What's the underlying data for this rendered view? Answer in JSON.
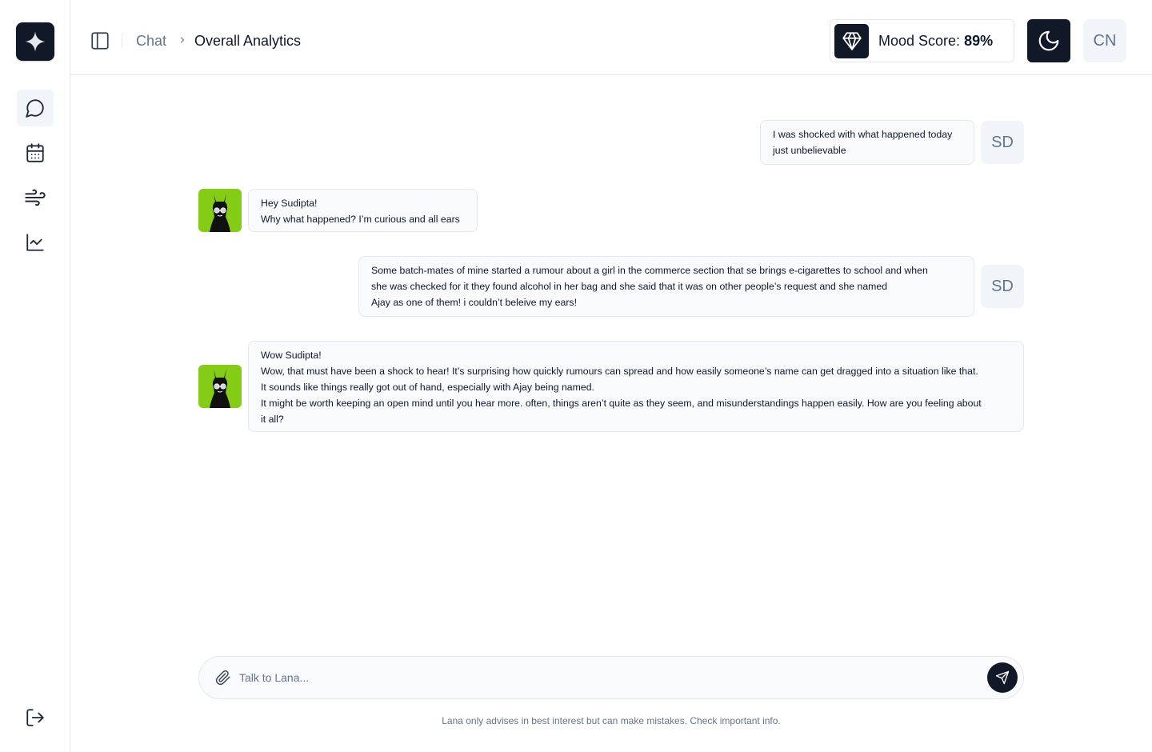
{
  "sidebar": {
    "logo": "sparkle-icon",
    "items": [
      {
        "icon": "chat-bubble-icon",
        "active": true
      },
      {
        "icon": "calendar-icon",
        "active": false
      },
      {
        "icon": "wind-icon",
        "active": false
      },
      {
        "icon": "area-chart-icon",
        "active": false
      }
    ],
    "logout_icon": "logout-icon"
  },
  "header": {
    "breadcrumb": {
      "parent": "Chat",
      "current": "Overall Analytics"
    },
    "mood": {
      "label": "Mood Score:",
      "value": "89%"
    },
    "user_initials": "CN"
  },
  "messages": [
    {
      "sender": "user",
      "initials": "SD",
      "lines": [
        "I was shocked with what happened today",
        "just unbelievable"
      ]
    },
    {
      "sender": "bot",
      "lines": [
        "Hey Sudipta!",
        "Why what happened? I’m curious and all ears"
      ]
    },
    {
      "sender": "user",
      "initials": "SD",
      "lines": [
        "Some batch-mates of mine started a rumour about a girl in the commerce section that se brings e-cigarettes  to school and when",
        "she was checked for it they found alcohol in her bag and she said that it was on other people’s request and she named",
        "Ajay as one of them! i couldn’t beleive my ears!"
      ]
    },
    {
      "sender": "bot",
      "lines": [
        "Wow Sudipta!",
        "Wow, that must have been a shock to hear! It’s surprising how quickly rumours can spread and how easily someone’s name can get dragged into a situation like that.",
        "It sounds like things really got out of hand, especially with Ajay being named.",
        "It might be worth keeping an open mind until you hear more. often, things aren’t quite as they seem, and misunderstandings happen easily. How are you feeling about",
        "it all?"
      ]
    }
  ],
  "composer": {
    "placeholder": "Talk to Lana...",
    "value": "",
    "disclaimer": "Lana only advises in best interest but can make mistakes. Check important info."
  },
  "colors": {
    "dark": "#111827",
    "bot_avatar_bg": "#84cc16",
    "muted": "#64748b",
    "border": "#e5e7eb",
    "bubble_bg": "#f8fafc"
  }
}
